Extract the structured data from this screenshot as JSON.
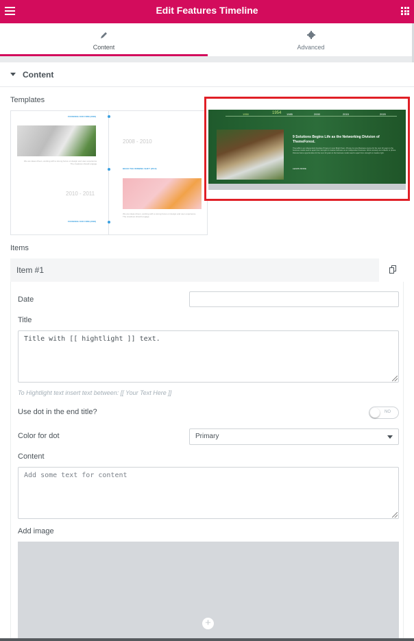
{
  "header": {
    "title": "Edit Features Timeline"
  },
  "tabs": [
    {
      "label": "Content"
    },
    {
      "label": "Advanced"
    }
  ],
  "section": {
    "title": "Content"
  },
  "templates": {
    "label": "Templates",
    "t1": {
      "year_a": "2008 - 2010",
      "year_b": "2010 - 2011",
      "head_a": "FOUNDING OUR FIRM (2008)",
      "head_b": "BEGIN THE WINNING SHIFT (2010)",
      "head_c": "FOUNDING OUR FIRM (2008)",
      "para": "We are ideas driven, working with a strong focus on design and user experience. The creatives should engage."
    },
    "t2": {
      "years": [
        "1950",
        "1954",
        "1985",
        "2000",
        "2015",
        "2020"
      ],
      "heading": "9 Solutions Begins Life as the Networking Division of ThemeForest.",
      "para": "ThemeBin is an independent boutique Privacy & more Bright Team. Privacy & more Business course for the next 10 years to the business model used to apart from strength to creative business as an independent business. Work remotely via LinkedIn or phone. Discuss future opportunities for the next 10 years to the business model used to apart from strength to creative right.",
      "link": "LEARN MORE"
    }
  },
  "items": {
    "label": "Items",
    "item_title": "Item #1",
    "date_label": "Date",
    "date_value": "",
    "title_label": "Title",
    "title_value": "Title with [[ hightlight ]] text.",
    "hint": "To Hightlight text insert text between: [[ Your Text Here ]]",
    "dot_label": "Use dot in the end title?",
    "dot_toggle": "NO",
    "color_label": "Color for dot",
    "color_value": "Primary",
    "content_label": "Content",
    "content_placeholder": "Add some text for content",
    "image_label": "Add image"
  },
  "colors": {
    "brand": "#d30c5c",
    "highlight_border": "#e01f26"
  }
}
